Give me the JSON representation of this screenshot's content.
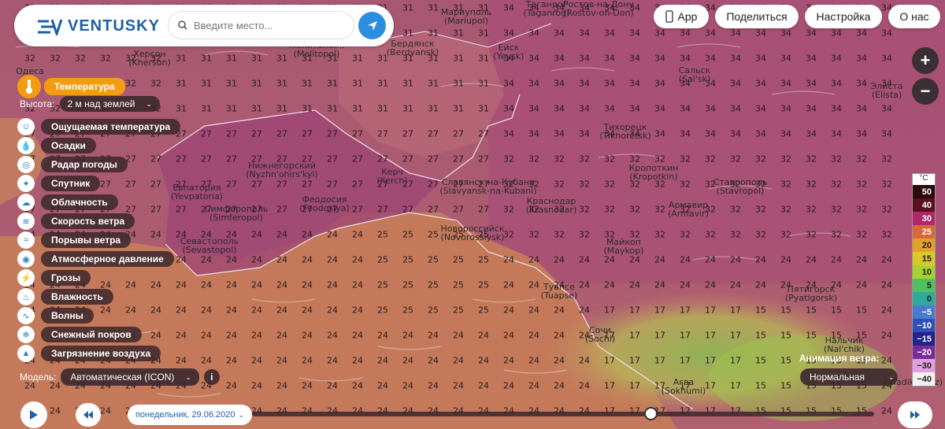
{
  "header": {
    "logo_text": "VENTUSKY",
    "search_placeholder": "Введите место..."
  },
  "top_buttons": {
    "app": "App",
    "share": "Поделиться",
    "settings": "Настройка",
    "about": "О нас"
  },
  "layers": {
    "active": "Температура",
    "height_label": "Высота:",
    "height_value": "2 м над землей",
    "items": [
      "Ощущаемая температура",
      "Осадки",
      "Радар погоды",
      "Спутник",
      "Облачность",
      "Скорость ветра",
      "Порывы ветра",
      "Атмосферное давление",
      "Грозы",
      "Влажность",
      "Волны",
      "Снежный покров",
      "Загрязнение воздуха"
    ]
  },
  "model": {
    "label": "Модель:",
    "value": "Автоматическая (ICON)"
  },
  "wind_animation": {
    "label": "Анимация ветра:",
    "value": "Нормальная"
  },
  "timeline": {
    "date": "понедельник, 29.06.2020"
  },
  "legend": {
    "unit": "°C",
    "entries": [
      {
        "value": "50",
        "color": "#2b0a0a",
        "text": "#fff"
      },
      {
        "value": "40",
        "color": "#5a1020",
        "text": "#fff"
      },
      {
        "value": "30",
        "color": "#b02868",
        "text": "#fff"
      },
      {
        "value": "25",
        "color": "#d86a3a",
        "text": "#fff"
      },
      {
        "value": "20",
        "color": "#e2a02a",
        "text": "#222"
      },
      {
        "value": "15",
        "color": "#d8c82a",
        "text": "#222"
      },
      {
        "value": "10",
        "color": "#a8d030",
        "text": "#222"
      },
      {
        "value": "5",
        "color": "#50c060",
        "text": "#222"
      },
      {
        "value": "0",
        "color": "#30a8a0",
        "text": "#222"
      },
      {
        "value": "−5",
        "color": "#4a7ad0",
        "text": "#fff"
      },
      {
        "value": "−10",
        "color": "#3050b8",
        "text": "#fff"
      },
      {
        "value": "−15",
        "color": "#23238a",
        "text": "#fff"
      },
      {
        "value": "−20",
        "color": "#7a2a9a",
        "text": "#fff"
      },
      {
        "value": "−30",
        "color": "#e0a0e0",
        "text": "#222"
      },
      {
        "value": "−40",
        "color": "#f2f2f2",
        "text": "#222"
      }
    ]
  },
  "cities": [
    {
      "name": "Херсон",
      "lat": "(Kherson)"
    },
    {
      "name": "Одеса",
      "lat": ""
    },
    {
      "name": "Мариуполь",
      "lat": "(Mariupol)"
    },
    {
      "name": "Таганрог",
      "lat": "(Taganrog)"
    },
    {
      "name": "Ростов-на-Дону",
      "lat": "(Rostov-on-Don)"
    },
    {
      "name": "Мелитополь",
      "lat": "(Melitopol)"
    },
    {
      "name": "Бердянск",
      "lat": "(Berdyansk)"
    },
    {
      "name": "Ейск",
      "lat": "(Yeysk)"
    },
    {
      "name": "Сальск",
      "lat": "(Sal'sk)"
    },
    {
      "name": "Элиста",
      "lat": "(Elista)"
    },
    {
      "name": "Тихорецк",
      "lat": "(Tikhoretsk)"
    },
    {
      "name": "Кропоткин",
      "lat": "(Kropotkin)"
    },
    {
      "name": "Нижнегорский",
      "lat": "(Nyzhn'ohirs'kyi)"
    },
    {
      "name": "Керч",
      "lat": "(Kerch)"
    },
    {
      "name": "Славянск-на-Кубани",
      "lat": "(Slavyansk-na-Kubani)"
    },
    {
      "name": "Евпатория",
      "lat": "(Yevpatoria)"
    },
    {
      "name": "Симферополь",
      "lat": "(Simferopol)"
    },
    {
      "name": "Феодосия",
      "lat": "(Feodosiya)"
    },
    {
      "name": "Краснодар",
      "lat": "(Krasnodar)"
    },
    {
      "name": "Армавир",
      "lat": "(Armavir)"
    },
    {
      "name": "Ставрополь",
      "lat": "(Stavropol)"
    },
    {
      "name": "Севастополь",
      "lat": "(Sevastopol)"
    },
    {
      "name": "Новороссийск",
      "lat": "(Novorossiysk)"
    },
    {
      "name": "Майкоп",
      "lat": "(Maykop)"
    },
    {
      "name": "Туапсе",
      "lat": "(Tuapse)"
    },
    {
      "name": "Пятигорск",
      "lat": "(Pyatigorsk)"
    },
    {
      "name": "Сочи",
      "lat": "(Sochi)"
    },
    {
      "name": "Нальчик",
      "lat": "(Nal'chik)"
    },
    {
      "name": "Агва",
      "lat": "(Sokhumi)"
    },
    {
      "name": "",
      "lat": "(Vladikavkaz)"
    }
  ]
}
